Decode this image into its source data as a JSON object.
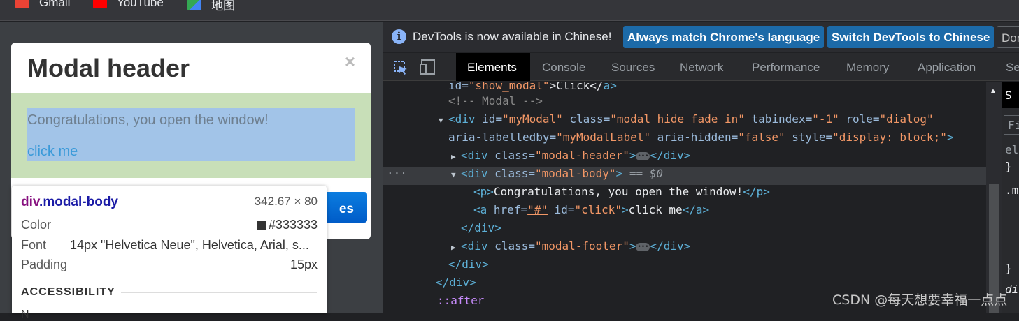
{
  "bookmarks": [
    {
      "label": "Gmail",
      "icon": "gmail-icon",
      "color": "#ea4335"
    },
    {
      "label": "YouTube",
      "icon": "youtube-icon",
      "color": "#ff0000"
    },
    {
      "label": "地图",
      "icon": "maps-icon",
      "color": "#34a853"
    }
  ],
  "modal": {
    "title": "Modal header",
    "close": "×",
    "body_text": "Congratulations, you open the window!",
    "body_link": "click me",
    "button_fragment": "es"
  },
  "tooltip": {
    "element": "div",
    "class": ".modal-body",
    "size": "342.67 × 80",
    "rows": [
      {
        "label": "Color",
        "value": "#333333"
      },
      {
        "label": "Font",
        "value": "14px \"Helvetica Neue\", Helvetica, Arial, s..."
      },
      {
        "label": "Padding",
        "value": "15px"
      }
    ],
    "section": "ACCESSIBILITY",
    "cut_label": "N"
  },
  "devtools": {
    "info_text": "DevTools is now available in Chinese!",
    "btn_match": "Always match Chrome's language",
    "btn_switch": "Switch DevTools to Chinese",
    "btn_dont": "Don",
    "tabs": [
      "Elements",
      "Console",
      "Sources",
      "Network",
      "Performance",
      "Memory",
      "Application",
      "Se"
    ],
    "active_tab": "Elements",
    "styles_panel": {
      "tab": "S",
      "filter": "Fi",
      "lines": [
        "el",
        "}",
        ".m",
        "}",
        "di"
      ]
    }
  },
  "dom": {
    "l0": {
      "a1": "id=",
      "v1": "\"show_modal\"",
      "t": ">Click</",
      "tag": "a>"
    },
    "l1": "<!-- Modal -->",
    "l2": {
      "open": "<div ",
      "id_a": "id=",
      "id_v": "\"myModal\"",
      "cls_a": " class=",
      "cls_v": "\"modal hide fade in\"",
      "tab_a": " tabindex=",
      "tab_v": "\"-1\"",
      "role_a": " role=",
      "role_v": "\"dialog\""
    },
    "l3": {
      "lab_a": "aria-labelledby=",
      "lab_v": "\"myModalLabel\"",
      "hid_a": " aria-hidden=",
      "hid_v": "\"false\"",
      "sty_a": " style=",
      "sty_v": "\"display: block;\"",
      "close": ">"
    },
    "l4": {
      "open": "<div ",
      "a": "class=",
      "v": "\"modal-header\"",
      "close": ">",
      "end": "</div>"
    },
    "l5": {
      "open": "<div ",
      "a": "class=",
      "v": "\"modal-body\"",
      "close": ">",
      "eq": " == ",
      "ref": "$0"
    },
    "l6": {
      "open": "<p>",
      "t": "Congratulations, you open the window!",
      "close": "</p>"
    },
    "l7": {
      "open": "<a ",
      "a1": "href=",
      "v1": "\"#\"",
      "a2": " id=",
      "v2": "\"click\"",
      "gt": ">",
      "t": "click me",
      "close": "</a>"
    },
    "l8": "</div>",
    "l9": {
      "open": "<div ",
      "a": "class=",
      "v": "\"modal-footer\"",
      "close": ">",
      "end": "</div>"
    },
    "l10": "</div>",
    "l11": "</div>",
    "l12": "::after",
    "gutter": "···"
  },
  "watermark": "CSDN @每天想要幸福一点点"
}
